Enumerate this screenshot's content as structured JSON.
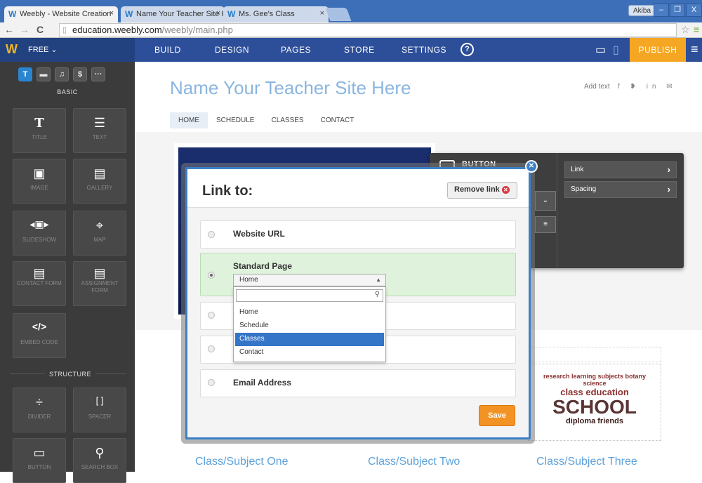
{
  "browser": {
    "tabs": [
      {
        "label": "Weebly - Website Creation",
        "close": "×"
      },
      {
        "label": "Name Your Teacher Site H",
        "close": "×"
      },
      {
        "label": "Ms. Gee's Class",
        "close": "×"
      }
    ],
    "favicon": "W",
    "user": "Akiba",
    "window_controls": [
      "–",
      "❐",
      "X"
    ],
    "url_host": "education.weebly.com",
    "url_path": "/weebly/main.php",
    "nav_icons": [
      "←",
      "→",
      "C"
    ]
  },
  "weebly_bar": {
    "plan": "FREE ⌄",
    "nav": [
      "BUILD",
      "DESIGN",
      "PAGES",
      "STORE",
      "SETTINGS"
    ],
    "help": "?",
    "publish": "PUBLISH",
    "brand_color": "#f5b522",
    "publish_color": "#f5a623"
  },
  "sidebar": {
    "categories": [
      "T",
      "▬",
      "♫",
      "$",
      "···"
    ],
    "basic_label": "BASIC",
    "structure_label": "STRUCTURE",
    "tiles": [
      {
        "icon": "T",
        "label": "TITLE",
        "name": "title"
      },
      {
        "icon": "☰",
        "label": "TEXT",
        "name": "text"
      },
      {
        "icon": "▣",
        "label": "IMAGE",
        "name": "image"
      },
      {
        "icon": "▤",
        "label": "GALLERY",
        "name": "gallery"
      },
      {
        "icon": "◂▣▸",
        "label": "SLIDESHOW",
        "name": "slideshow"
      },
      {
        "icon": "⌖",
        "label": "MAP",
        "name": "map"
      },
      {
        "icon": "▤",
        "label": "CONTACT FORM",
        "name": "contact-form"
      },
      {
        "icon": "▤",
        "label": "ASSIGNMENT FORM",
        "name": "assignment-form"
      },
      {
        "icon": "</>",
        "label": "EMBED CODE",
        "name": "embed-code"
      },
      {
        "icon": "÷",
        "label": "DIVIDER",
        "name": "divider"
      },
      {
        "icon": "[ ]",
        "label": "SPACER",
        "name": "spacer"
      },
      {
        "icon": "▭",
        "label": "BUTTON",
        "name": "button"
      },
      {
        "icon": "⚲",
        "label": "SEARCH BOX",
        "name": "search-box"
      }
    ]
  },
  "site": {
    "title": "Name Your Teacher Site Here",
    "add_text": "Add text",
    "social": "f  ❥  in  ✉",
    "nav": [
      "HOME",
      "SCHEDULE",
      "CLASSES",
      "CONTACT"
    ],
    "class_titles": [
      "Class/Subject One",
      "Class/Subject Two",
      "Class/Subject Three"
    ],
    "wordcloud": {
      "top": "research learning subjects botany science",
      "mid": "class education",
      "big": "SCHOOL",
      "bottom": "diploma friends"
    }
  },
  "button_panel": {
    "label": "BUTTON",
    "items": [
      "Link",
      "Spacing"
    ],
    "arrow": "›"
  },
  "link_modal": {
    "title": "Link to:",
    "remove_link": "Remove link",
    "remove_icon": "✕",
    "close": "✕",
    "options": [
      "Website URL",
      "Standard Page",
      "",
      "",
      "Email Address"
    ],
    "selected_index": 1,
    "page_select_value": "Home",
    "dropdown_options": [
      "Home",
      "Schedule",
      "Classes",
      "Contact"
    ],
    "dropdown_highlight": "Classes",
    "save": "Save",
    "accent": "#3d7fc5"
  }
}
